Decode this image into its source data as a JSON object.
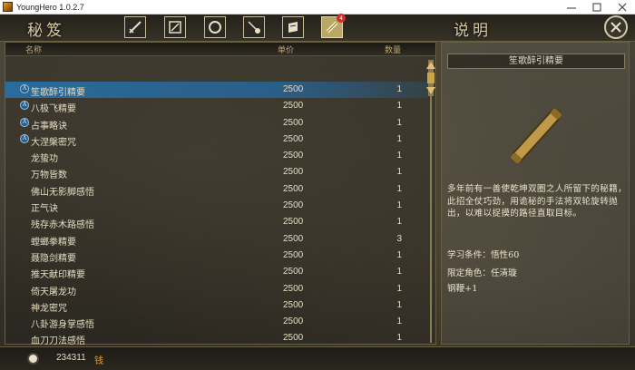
{
  "window": {
    "title": "YoungHero 1.0.2.7"
  },
  "header": {
    "section_title": "秘笈",
    "desc_title": "说明",
    "tabs": [
      {
        "icon": "sword-icon"
      },
      {
        "icon": "scroll-icon"
      },
      {
        "icon": "ring-icon"
      },
      {
        "icon": "potion-icon"
      },
      {
        "icon": "book-icon"
      },
      {
        "icon": "secret-scroll-icon",
        "badge": "4",
        "active": true
      }
    ]
  },
  "list": {
    "headers": {
      "name": "名称",
      "price": "单价",
      "qty": "数量"
    },
    "items": [
      {
        "name": "笙歌醉引精要",
        "price": "2500",
        "qty": "1",
        "icon": true,
        "icon_label": "A",
        "selected": true
      },
      {
        "name": "八极飞精要",
        "price": "2500",
        "qty": "1",
        "icon": true,
        "icon_label": "A"
      },
      {
        "name": "占事略诀",
        "price": "2500",
        "qty": "1",
        "icon": true,
        "icon_label": "A"
      },
      {
        "name": "大涅槃密咒",
        "price": "2500",
        "qty": "1",
        "icon": true,
        "icon_label": "A"
      },
      {
        "name": "龙蛰功",
        "price": "2500",
        "qty": "1"
      },
      {
        "name": "万物皆数",
        "price": "2500",
        "qty": "1"
      },
      {
        "name": "佛山无影脚感悟",
        "price": "2500",
        "qty": "1"
      },
      {
        "name": "正气诀",
        "price": "2500",
        "qty": "1"
      },
      {
        "name": "残存赤木路感悟",
        "price": "2500",
        "qty": "1"
      },
      {
        "name": "螳螂拳精要",
        "price": "2500",
        "qty": "3"
      },
      {
        "name": "聂隐剑精要",
        "price": "2500",
        "qty": "1"
      },
      {
        "name": "推天献印精要",
        "price": "2500",
        "qty": "1"
      },
      {
        "name": "倚天屠龙功",
        "price": "2500",
        "qty": "1"
      },
      {
        "name": "神龙密咒",
        "price": "2500",
        "qty": "1"
      },
      {
        "name": "八卦游身掌感悟",
        "price": "2500",
        "qty": "1"
      },
      {
        "name": "血刀刀法感悟",
        "price": "2500",
        "qty": "1"
      }
    ]
  },
  "details": {
    "name": "笙歌醉引精要",
    "description": "多年前有一善使乾坤双圈之人所留下的秘籍，此招全仗巧劲，用诡秘的手法将双轮旋转抛出，以难以捉摸的路径直取目标。",
    "requirement": "学习条件：悟性60",
    "character": "限定角色：任清璇",
    "bonus": "钢鞭+1"
  },
  "footer": {
    "money": "234311",
    "money_unit": "钱"
  }
}
